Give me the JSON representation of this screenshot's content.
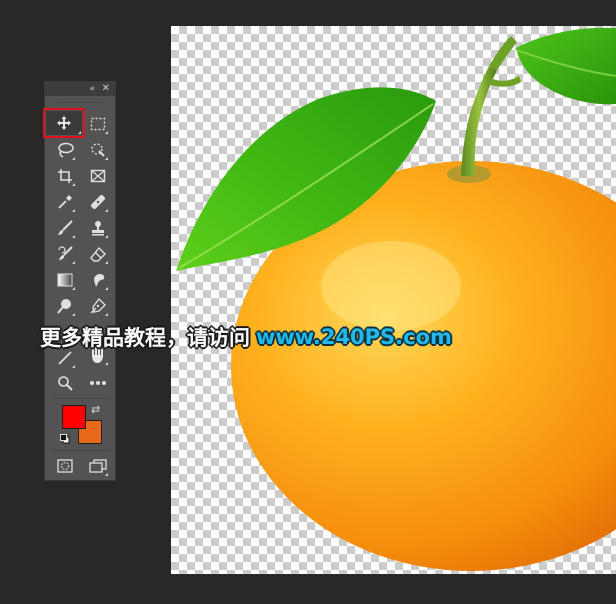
{
  "panel": {
    "collapse_glyph": "«",
    "close_glyph": "✕",
    "tools": [
      {
        "id": "move",
        "icon": "move-icon",
        "selected": true
      },
      {
        "id": "marquee",
        "icon": "rectangular-marquee-icon"
      },
      {
        "id": "lasso",
        "icon": "lasso-icon"
      },
      {
        "id": "quick-select",
        "icon": "quick-selection-icon"
      },
      {
        "id": "crop",
        "icon": "crop-icon"
      },
      {
        "id": "frame",
        "icon": "frame-icon"
      },
      {
        "id": "eyedropper",
        "icon": "eyedropper-icon"
      },
      {
        "id": "healing",
        "icon": "healing-brush-icon"
      },
      {
        "id": "brush",
        "icon": "brush-icon"
      },
      {
        "id": "stamp",
        "icon": "clone-stamp-icon"
      },
      {
        "id": "history-brush",
        "icon": "history-brush-icon"
      },
      {
        "id": "eraser",
        "icon": "eraser-icon"
      },
      {
        "id": "gradient",
        "icon": "gradient-icon"
      },
      {
        "id": "smudge",
        "icon": "smudge-icon"
      },
      {
        "id": "dodge",
        "icon": "dodge-icon"
      },
      {
        "id": "pen",
        "icon": "pen-icon"
      },
      {
        "id": "line",
        "icon": "line-icon"
      },
      {
        "id": "hand",
        "icon": "hand-icon"
      },
      {
        "id": "zoom",
        "icon": "zoom-icon"
      },
      {
        "id": "more",
        "icon": "more-tools-icon"
      },
      {
        "id": "quick-mask",
        "icon": "quick-mask-icon"
      },
      {
        "id": "screen-mode",
        "icon": "screen-mode-icon"
      }
    ],
    "foreground_color": "#ff0000",
    "background_color": "#e8691a",
    "swap_glyph": "⇄"
  },
  "watermark": {
    "chinese": "更多精品教程，请访问",
    "url": "www.240PS.com"
  },
  "colors": {
    "workspace": "#282828",
    "panel": "#535353",
    "selection_highlight": "#e0101c",
    "url_blue": "#22b8e8"
  }
}
